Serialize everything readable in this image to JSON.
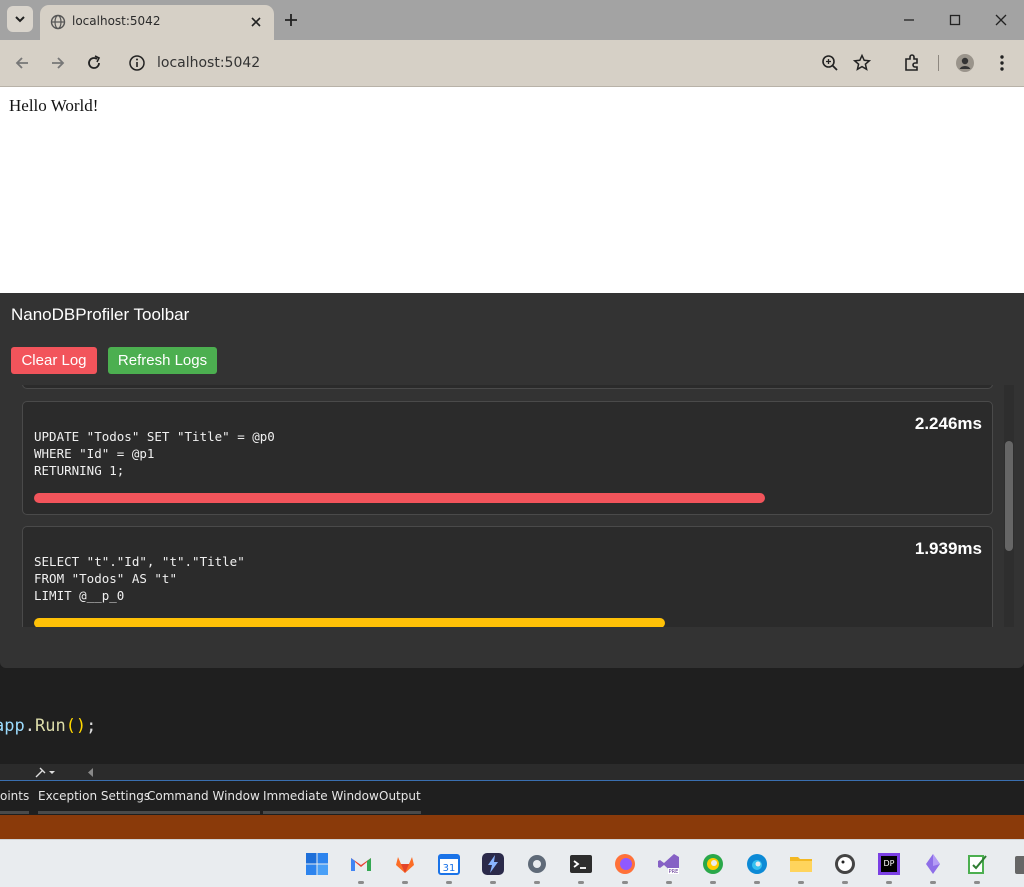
{
  "browser": {
    "tab_title": "localhost:5042",
    "url": "localhost:5042"
  },
  "page": {
    "hello_text": "Hello World!"
  },
  "profiler": {
    "title": "NanoDBProfiler Toolbar",
    "clear_label": "Clear Log",
    "refresh_label": "Refresh Logs",
    "logs": [
      {
        "sql": "UPDATE \"Todos\" SET \"Title\" = @p0\nWHERE \"Id\" = @p1\nRETURNING 1;",
        "duration": "2.246ms",
        "bar_fraction": 0.77,
        "bar_color": "#f2545b"
      },
      {
        "sql": "SELECT \"t\".\"Id\", \"t\".\"Title\"\nFROM \"Todos\" AS \"t\"\nLIMIT @__p_0",
        "duration": "1.939ms",
        "bar_fraction": 0.665,
        "bar_color": "#ffc107"
      }
    ]
  },
  "ide": {
    "code_obj": "app",
    "code_fn": "Run",
    "tabs": [
      "oints",
      "Exception Settings",
      "Command Window",
      "Immediate Window",
      "Output"
    ]
  },
  "taskbar": {
    "icons": [
      "windows-start-icon",
      "gmail-icon",
      "gitlab-icon",
      "calendar-icon",
      "power-automate-icon",
      "settings-icon",
      "terminal-icon",
      "firefox-icon",
      "visual-studio-preview-icon",
      "edge-dev-icon",
      "edge-icon",
      "file-explorer-icon",
      "duck-app-icon",
      "dotpeek-icon",
      "crystal-icon",
      "notepad-icon",
      "partial-icon"
    ]
  }
}
